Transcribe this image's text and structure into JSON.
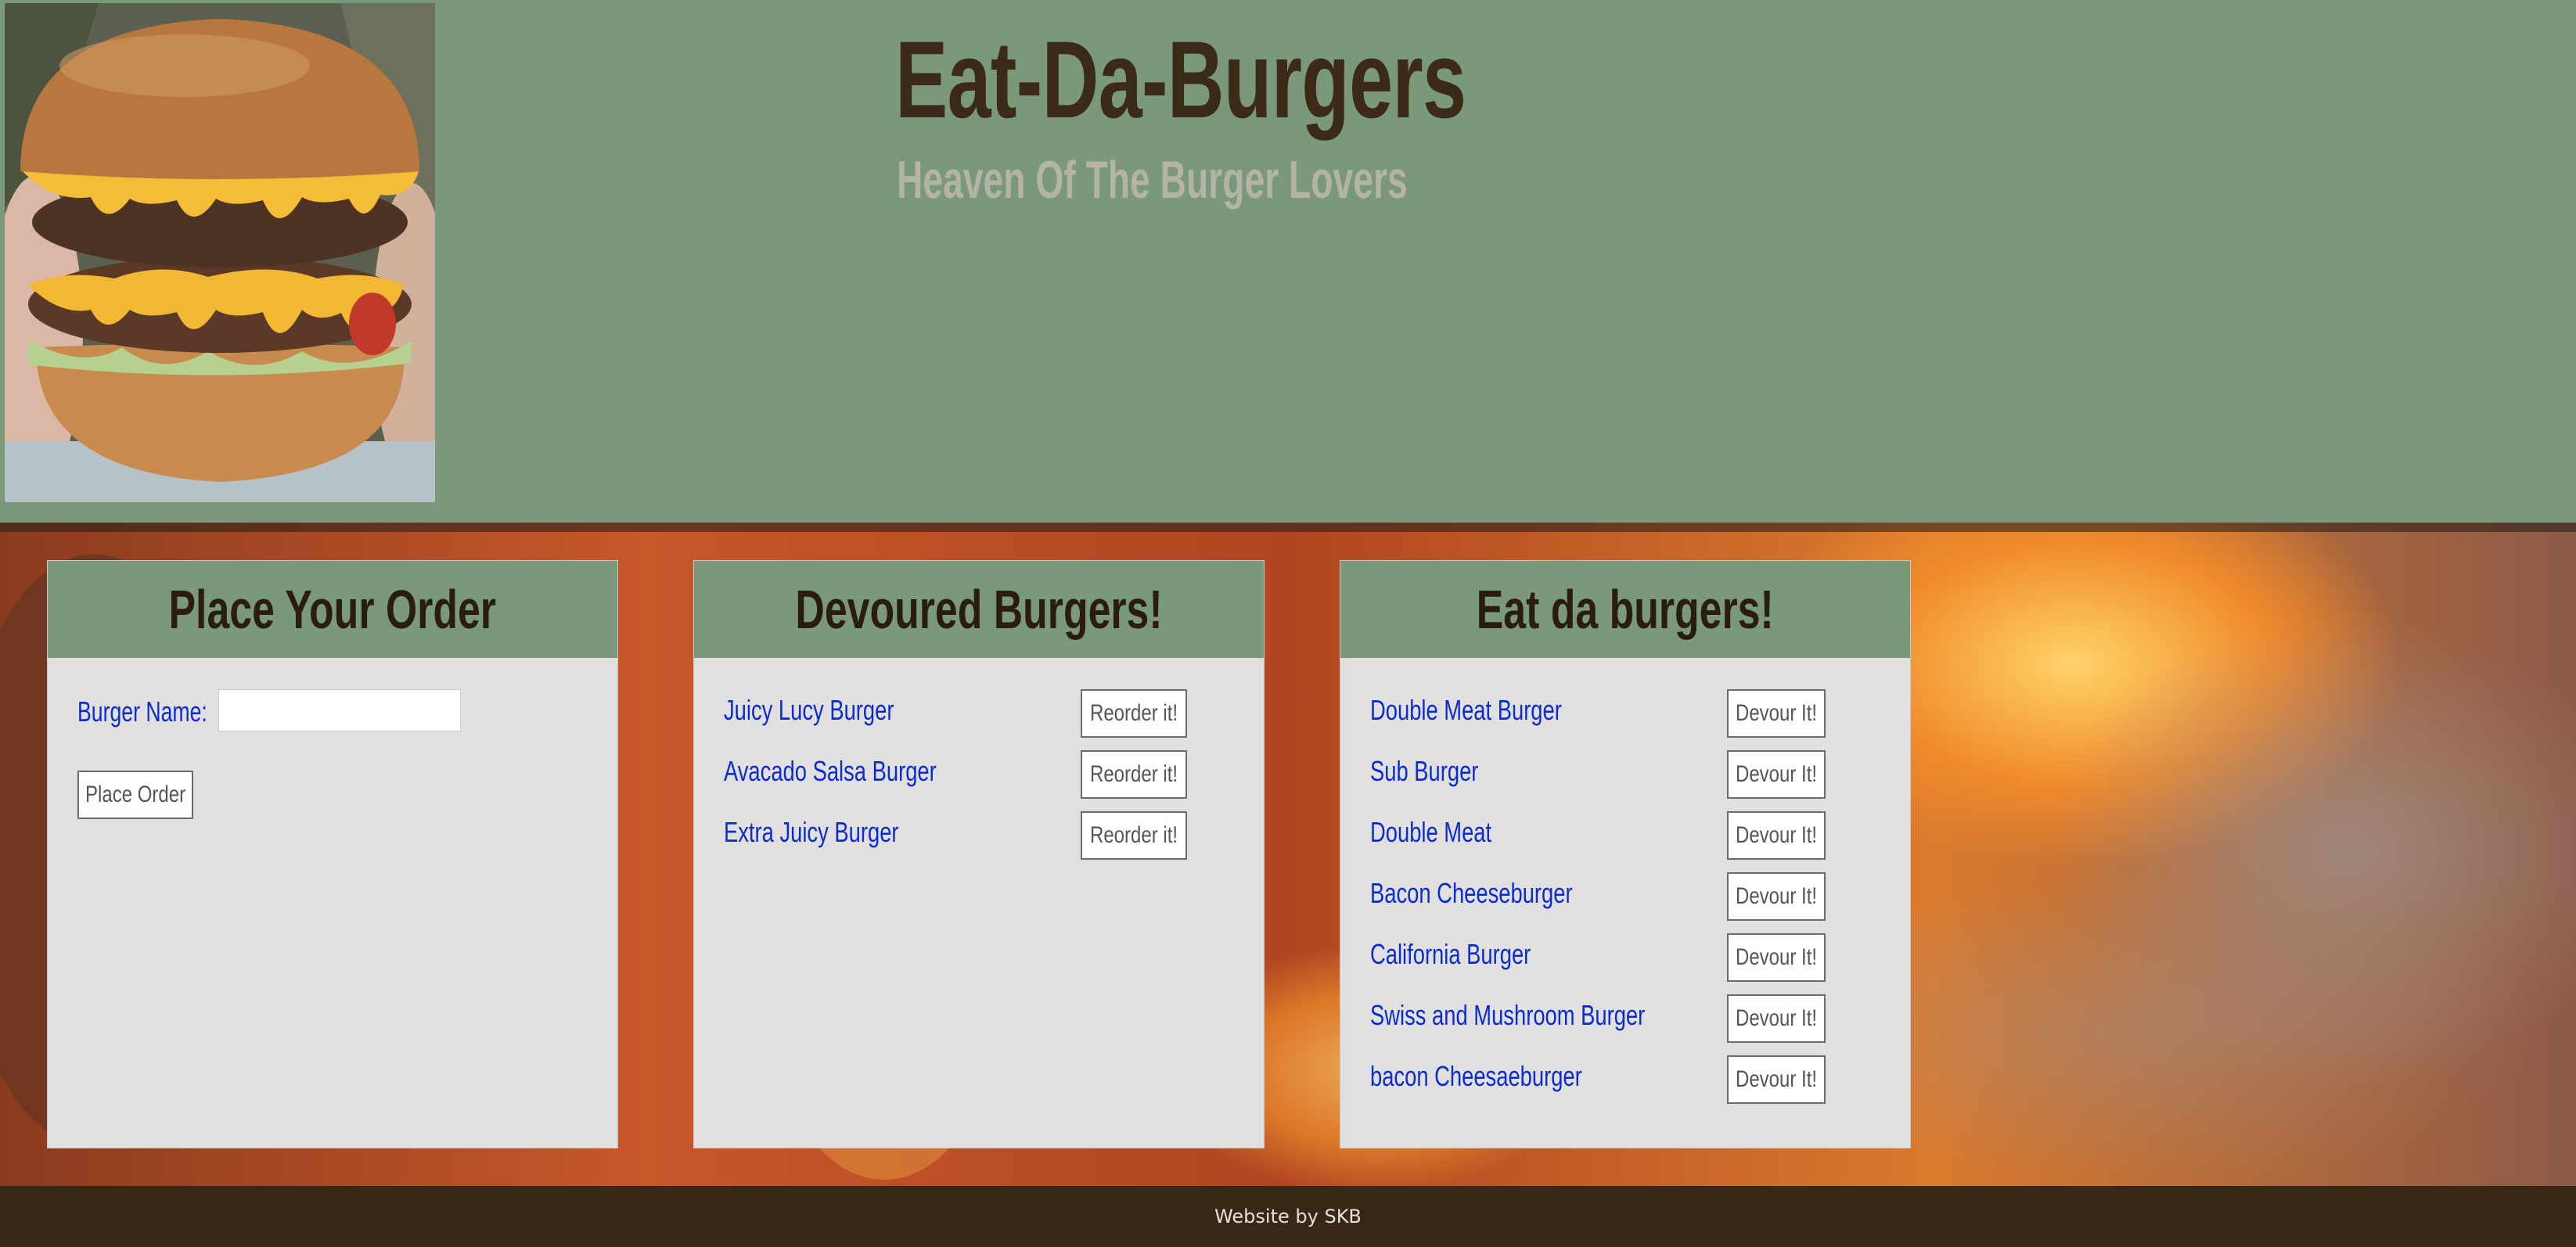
{
  "header": {
    "title": "Eat-Da-Burgers",
    "subtitle": "Heaven Of The Burger Lovers",
    "image": "burger-photo"
  },
  "order_panel": {
    "title": "Place Your Order",
    "name_label": "Burger Name:",
    "name_value": "",
    "submit_label": "Place Order"
  },
  "devoured_panel": {
    "title": "Devoured Burgers!",
    "items": [
      {
        "name": "Juicy Lucy Burger",
        "button": "Reorder it!"
      },
      {
        "name": "Avacado Salsa Burger",
        "button": "Reorder it!"
      },
      {
        "name": "Extra Juicy Burger",
        "button": "Reorder it!"
      }
    ]
  },
  "eat_panel": {
    "title": "Eat da burgers!",
    "items": [
      {
        "name": "Double Meat Burger",
        "button": "Devour It!"
      },
      {
        "name": "Sub Burger",
        "button": "Devour It!"
      },
      {
        "name": "Double Meat",
        "button": "Devour It!"
      },
      {
        "name": "Bacon Cheeseburger",
        "button": "Devour It!"
      },
      {
        "name": "California Burger",
        "button": "Devour It!"
      },
      {
        "name": "Swiss and Mushroom Burger",
        "button": "Devour It!"
      },
      {
        "name": "bacon Cheesaeburger",
        "button": "Devour It!"
      }
    ]
  },
  "footer": {
    "text": "Website by SKB"
  },
  "colors": {
    "header_bg": "#7a997a",
    "title": "#3a2a17",
    "subtitle": "#b3b3a6",
    "panel_bg": "#e2e0df",
    "link": "#0a2ccf",
    "footer_bg": "#362717"
  }
}
